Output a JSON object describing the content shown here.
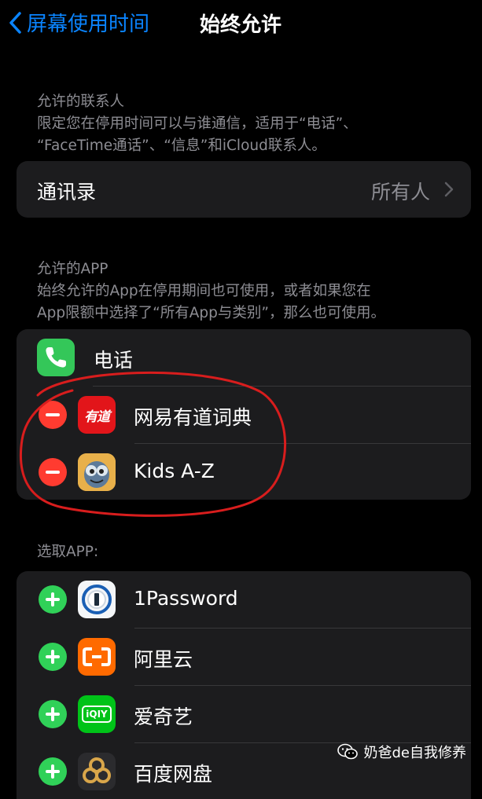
{
  "nav": {
    "back_label": "屏幕使用时间",
    "title": "始终允许"
  },
  "contacts_section": {
    "header_title": "允许的联系人",
    "header_line1": "限定您在停用时间可以与谁通信，适用于“电话”、",
    "header_line2": "“FaceTime通话”、“信息”和iCloud联系人。",
    "row_label": "通讯录",
    "row_value": "所有人"
  },
  "allowed_section": {
    "header_title": "允许的APP",
    "header_line1": "始终允许的App在停用期间也可使用，或者如果您在",
    "header_line2": "App限额中选择了“所有App与类别”，那么也可使用。",
    "apps": [
      {
        "label": "电话"
      },
      {
        "label": "网易有道词典",
        "icon_text": "有道"
      },
      {
        "label": "Kids A-Z"
      }
    ]
  },
  "choose_section": {
    "header_title": "选取APP:",
    "apps": [
      {
        "label": "1Password"
      },
      {
        "label": "阿里云"
      },
      {
        "label": "爱奇艺",
        "icon_text": "iQIY"
      },
      {
        "label": "百度网盘"
      }
    ]
  },
  "watermark": {
    "text": "奶爸de自我修养"
  },
  "colors": {
    "accent": "#0a84ff",
    "remove": "#ff3b30",
    "add": "#30d158",
    "annotation": "#d81d1d"
  }
}
